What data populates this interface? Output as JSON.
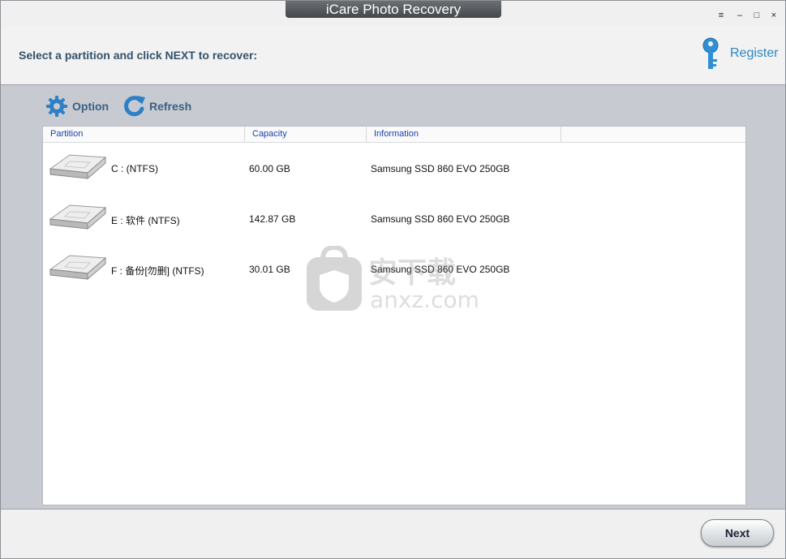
{
  "window": {
    "title": "iCare Photo Recovery",
    "controls": {
      "menu": "≡",
      "minimize": "–",
      "maximize": "□",
      "close": "×"
    }
  },
  "header": {
    "instruction": "Select a partition and click NEXT to recover:",
    "register_label": "Register"
  },
  "toolbar": {
    "option_label": "Option",
    "refresh_label": "Refresh"
  },
  "table": {
    "columns": [
      "Partition",
      "Capacity",
      "Information"
    ],
    "rows": [
      {
        "partition": "C :   (NTFS)",
        "capacity": "60.00 GB",
        "information": "Samsung SSD 860 EVO 250GB"
      },
      {
        "partition": "E : 软件  (NTFS)",
        "capacity": "142.87 GB",
        "information": "Samsung SSD 860 EVO 250GB"
      },
      {
        "partition": "F : 备份[勿删]  (NTFS)",
        "capacity": "30.01 GB",
        "information": "Samsung SSD 860 EVO 250GB"
      }
    ]
  },
  "watermark": {
    "text_cn": "安下载",
    "text_en": "anxz.com"
  },
  "footer": {
    "next_label": "Next"
  },
  "colors": {
    "accent": "#2e86c1",
    "header_text": "#34536c",
    "column_header_text": "#1b3fae"
  },
  "icons": [
    "key-icon",
    "gear-icon",
    "refresh-icon",
    "hard-drive-icon",
    "shield-icon"
  ]
}
